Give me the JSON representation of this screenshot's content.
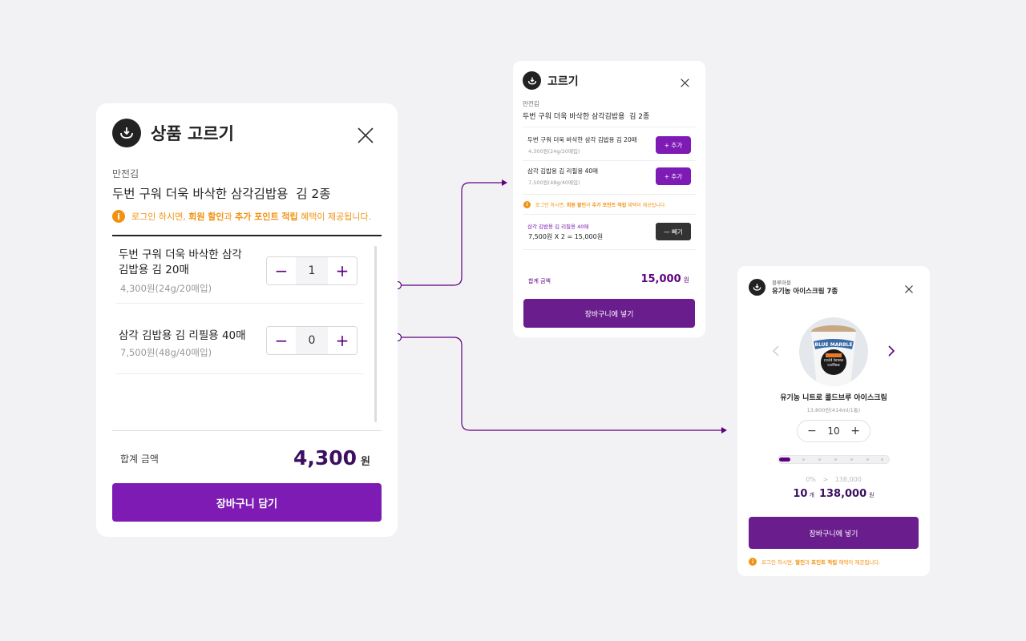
{
  "main_modal": {
    "title": "상품 고르기",
    "brand": "만전김",
    "product_title": "두번 구워 더욱 바삭한 삼각김밥용  김 2종",
    "notice": {
      "pre": "로그인 하시면, ",
      "b1": "회원 할인",
      "mid": "과 ",
      "b2": "추가 포인트 적립",
      "post": " 혜택이 제공됩니다."
    },
    "items": [
      {
        "name_line1": "두번 구워 더욱 바삭한 삼각",
        "name_line2": "김밥용 김 20매",
        "price": "4,300원(24g/20매입)",
        "qty": "1"
      },
      {
        "name_line1": "삼각 김밥용 김 리필용 40매",
        "name_line2": "",
        "price": "7,500원(48g/40매입)",
        "qty": "0"
      }
    ],
    "stepper_minus": "−",
    "stepper_plus": "+",
    "total_label": "합계 금액",
    "total_value": "4,300",
    "total_unit": "원",
    "cta": "장바구니 담기"
  },
  "variant_a": {
    "title": "고르기",
    "brand": "만전김",
    "product_title": "두번 구워 더욱 바삭한 삼각김밥용  김 2종",
    "items": [
      {
        "name": "두번 구워 더욱 바삭한 삼각 김밥용 김 20매",
        "price": "4,300원(24g/20매입)",
        "add_label": "+ 추가"
      },
      {
        "name": "삼각 김밥용 김 리필용 40매",
        "price": "7,500원(48g/40매입)",
        "add_label": "+ 추가"
      }
    ],
    "notice": {
      "pre": "로그인 하시면, ",
      "b1": "회원 할인",
      "mid": "과 ",
      "b2": "추가 포인트 적립",
      "post": " 혜택이 제공됩니다."
    },
    "selected": {
      "name": "삼각 김밥용 김 리필용 40매",
      "calc": "7,500원 X 2 = 15,000원",
      "remove_label": "— 빼기"
    },
    "total_label": "합계 금액",
    "total_value": "15,000",
    "total_unit": "원",
    "cta": "장바구니에 넣기"
  },
  "variant_b": {
    "brand": "블루마블",
    "product_title": "유기농 아이스크림 7종",
    "item_name": "유기농 니트로 콜드브루 아이스크림",
    "item_price": "13,800원(414ml/1통)",
    "cup_label_top": "BLUE MARBLE",
    "cup_label_bottom": "cold brew coffee",
    "qty": "10",
    "stepper_minus": "−",
    "stepper_plus": "+",
    "progress_fraction": 0.05,
    "discount_pct": "0%",
    "discount_arrow": ">",
    "discount_target": "138,000",
    "count_value": "10",
    "count_unit": "개",
    "total_value": "138,000",
    "total_unit": "원",
    "cta": "장바구니에 넣기",
    "notice": {
      "pre": "로그인 하시면, ",
      "b1": "할인",
      "mid": "과 ",
      "b2": "포인트 적립",
      "post": " 혜택이 제공됩니다."
    }
  },
  "colors": {
    "accent": "#7d1bb4",
    "accent_dark": "#5f0080",
    "notice": "#f29211",
    "background": "#f2f2f4"
  },
  "icons": {
    "logo": "bowl-arrow-icon",
    "close": "close-icon",
    "info": "info-icon",
    "prev": "chevron-left-icon",
    "next": "chevron-right-icon"
  }
}
